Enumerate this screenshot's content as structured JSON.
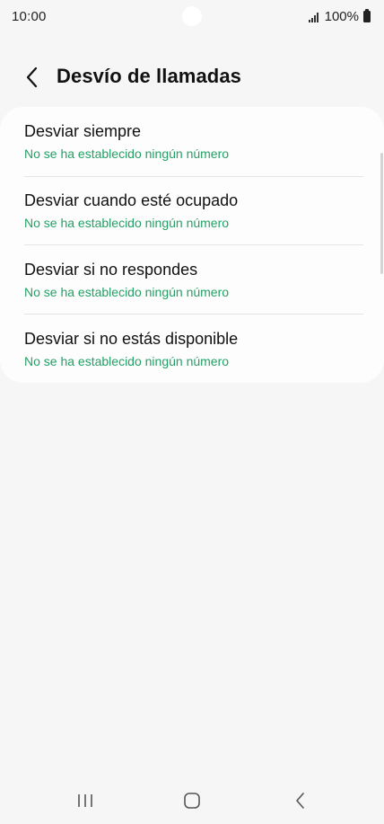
{
  "status_bar": {
    "time": "10:00",
    "battery": "100%"
  },
  "header": {
    "title": "Desvío de llamadas"
  },
  "forwarding_options": [
    {
      "title": "Desviar siempre",
      "subtitle": "No se ha establecido ningún número"
    },
    {
      "title": "Desviar cuando esté ocupado",
      "subtitle": "No se ha establecido ningún número"
    },
    {
      "title": "Desviar si no respondes",
      "subtitle": "No se ha establecido ningún número"
    },
    {
      "title": "Desviar si no estás disponible",
      "subtitle": "No se ha establecido ningún número"
    }
  ],
  "colors": {
    "accent": "#24a065",
    "background": "#f6f6f6",
    "card": "#fdfdfd"
  },
  "icons": {
    "back": "chevron-left-icon",
    "signal": "signal-icon",
    "battery": "battery-icon",
    "recent_apps": "recent-apps-icon",
    "home": "home-icon",
    "nav_back": "back-icon"
  }
}
